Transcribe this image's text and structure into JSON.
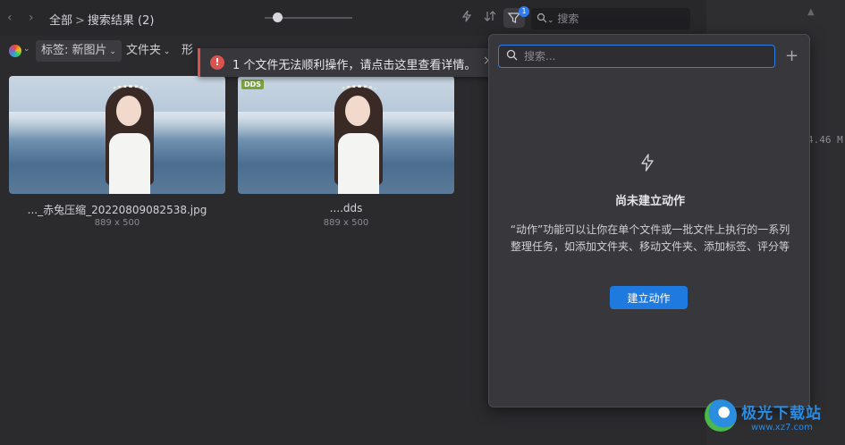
{
  "toolbar": {
    "back_icon": "chevron-left",
    "forward_icon": "chevron-right",
    "breadcrumb_root": "全部",
    "breadcrumb_separator": ">",
    "breadcrumb_current": "搜索结果 (2)",
    "filter_badge": "1",
    "search_placeholder": "搜索"
  },
  "filter_row": {
    "tag_chip": "标签: 新图片",
    "folder_chip": "文件夹",
    "partial_chip": "形"
  },
  "error_banner": {
    "message": "1 个文件无法顺利操作，请点击这里查看详情。",
    "close": "×"
  },
  "items": [
    {
      "name": "..._赤兔压缩_20220809082538.jpg",
      "dimensions": "889 x 500",
      "format_tag": ""
    },
    {
      "name": "....dds",
      "dimensions": "889 x 500",
      "format_tag": "DDS"
    }
  ],
  "actions_popover": {
    "search_placeholder": "搜索...",
    "add_icon": "+",
    "empty_title": "尚未建立动作",
    "empty_description": "“动作”功能可以让你在单个文件或一批文件上执行的一系列整理任务，如添加文件夹、移动文件夹、添加标签、评分等",
    "create_button": "建立动作"
  },
  "right_panel": {
    "partial_value": "4.46 M"
  },
  "watermark": {
    "name": "极光下载站",
    "url": "www.xz7.com"
  },
  "colors": {
    "accent": "#1f7ae0",
    "error": "#d9534f",
    "dds_tag": "#7aa43b"
  }
}
